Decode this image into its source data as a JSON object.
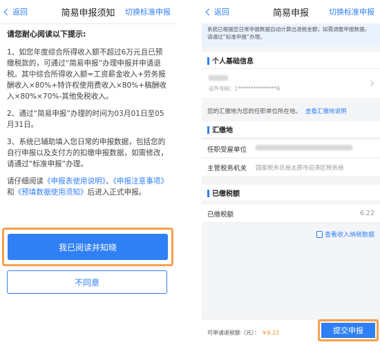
{
  "left": {
    "nav": {
      "back": "返回",
      "title": "简易申报须知",
      "switch": "切换标准申报"
    },
    "heading": "请您耐心阅读以下提示:",
    "para1": "1、如您年度综合所得收入额不超过6万元且已预缴税款的，可通过“简易申报”办理申报并申请退税。其中综合所得收入额=工资薪金收入+劳务报酬收入×80%+特许权使用费收入×80%+稿酬收入×80%×70%-其他免税收入。",
    "para2": "2、通过“简易申报”办理的时间为03月01日至05月31日。",
    "para3": "3、系统已辅助填入您日常的申报数据，包括您的自行申报以及支付方的扣缴申报数据，如需修改，请通过“标准申报”办理。",
    "para4_pre": "请仔细阅读",
    "link1": "《申报表使用说明》",
    "sep1": "、",
    "link2": "《申报注意事项》",
    "and": "和",
    "link3": "《预填数据使用须知》",
    "para4_post": "后进入正式申报。",
    "agree": "我已阅读并知晓",
    "disagree": "不同意"
  },
  "right": {
    "nav": {
      "back": "返回",
      "title": "简易申报",
      "switch": "切换标准申报"
    },
    "notice": "系统已根据您日常申报数据自动计算出退税金额；如需调整申报数据，请通过“标准申报”办理。",
    "basic_info_title": "个人基础信息",
    "id_label": "证件号码：1***************6",
    "location_text": "您的汇缴地为您的任职单位所在地。",
    "location_link": "查看汇缴地说明",
    "huijiao_title": "汇缴地",
    "employer_label": "任职受雇单位",
    "tax_office_label": "主管税务机关",
    "tax_office_value": "国家税务总局太原市迎泽区税务局",
    "paid_title": "已缴税额",
    "paid_label": "已缴税额",
    "paid_value": "6.22",
    "view_income": "查看收入纳税数据",
    "refund_label": "可申请退税额（元）：",
    "refund_amount": "￥6.22",
    "submit": "提交申报"
  }
}
